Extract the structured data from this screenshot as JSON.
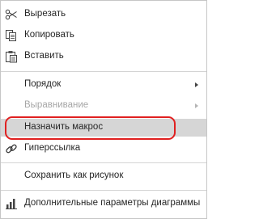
{
  "menu": {
    "cut": {
      "label": "Вырезать",
      "icon": "scissors-icon"
    },
    "copy": {
      "label": "Копировать",
      "icon": "copy-icon"
    },
    "paste": {
      "label": "Вставить",
      "icon": "paste-icon"
    },
    "order": {
      "label": "Порядок",
      "has_submenu": true
    },
    "align": {
      "label": "Выравнивание",
      "has_submenu": true,
      "disabled": true
    },
    "assign_macro": {
      "label": "Назначить макрос",
      "highlighted": true
    },
    "hyperlink": {
      "label": "Гиперссылка",
      "icon": "link-icon"
    },
    "save_as_picture": {
      "label": "Сохранить как рисунок"
    },
    "chart_options": {
      "label": "Дополнительные параметры диаграммы",
      "icon": "bar-chart-icon"
    }
  },
  "colors": {
    "highlight_background": "#d6d6d6",
    "annotation_outline": "#e02020",
    "disabled_text": "#a6a6a6"
  }
}
